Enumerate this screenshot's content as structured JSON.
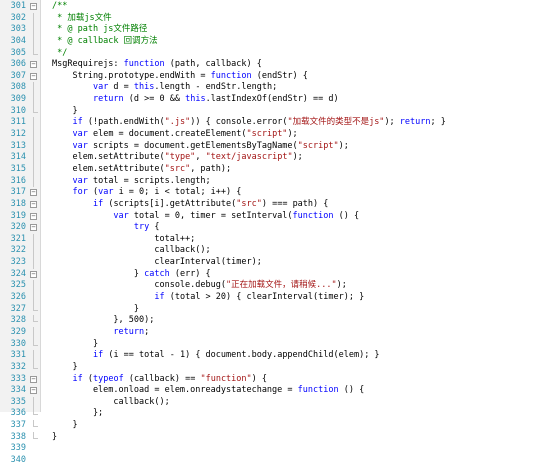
{
  "editor": {
    "lines": [
      {
        "n": "301",
        "fold": "open",
        "tokens": [
          {
            "c": "cm",
            "t": "/**"
          }
        ]
      },
      {
        "n": "302",
        "fold": "line",
        "tokens": [
          {
            "c": "cm",
            "t": " * 加载js文件"
          }
        ]
      },
      {
        "n": "303",
        "fold": "line",
        "tokens": [
          {
            "c": "cm",
            "t": " * @ path js文件路径"
          }
        ]
      },
      {
        "n": "304",
        "fold": "line",
        "tokens": [
          {
            "c": "cm",
            "t": " * @ callback 回调方法"
          }
        ]
      },
      {
        "n": "305",
        "fold": "end",
        "tokens": [
          {
            "c": "cm",
            "t": " */"
          }
        ]
      },
      {
        "n": "306",
        "fold": "open",
        "tokens": [
          {
            "c": "",
            "t": "MsgRequirejs: "
          },
          {
            "c": "kw",
            "t": "function"
          },
          {
            "c": "",
            "t": " (path, callback) {"
          }
        ]
      },
      {
        "n": "307",
        "fold": "open",
        "tokens": [
          {
            "c": "",
            "t": "    String.prototype.endWith = "
          },
          {
            "c": "kw",
            "t": "function"
          },
          {
            "c": "",
            "t": " (endStr) {"
          }
        ]
      },
      {
        "n": "308",
        "fold": "line",
        "tokens": [
          {
            "c": "",
            "t": "        "
          },
          {
            "c": "kw",
            "t": "var"
          },
          {
            "c": "",
            "t": " d = "
          },
          {
            "c": "kw",
            "t": "this"
          },
          {
            "c": "",
            "t": ".length - endStr.length;"
          }
        ]
      },
      {
        "n": "309",
        "fold": "line",
        "tokens": [
          {
            "c": "",
            "t": "        "
          },
          {
            "c": "kw",
            "t": "return"
          },
          {
            "c": "",
            "t": " (d >= 0 && "
          },
          {
            "c": "kw",
            "t": "this"
          },
          {
            "c": "",
            "t": ".lastIndexOf(endStr) == d)"
          }
        ]
      },
      {
        "n": "310",
        "fold": "end",
        "tokens": [
          {
            "c": "",
            "t": "    }"
          }
        ]
      },
      {
        "n": "311",
        "fold": "line",
        "tokens": [
          {
            "c": "",
            "t": "    "
          },
          {
            "c": "kw",
            "t": "if"
          },
          {
            "c": "",
            "t": " (!path.endWith("
          },
          {
            "c": "str",
            "t": "\".js\""
          },
          {
            "c": "",
            "t": ")) { console.error("
          },
          {
            "c": "str",
            "t": "\"加载文件的类型不是js\""
          },
          {
            "c": "",
            "t": "); "
          },
          {
            "c": "kw",
            "t": "return"
          },
          {
            "c": "",
            "t": "; }"
          }
        ]
      },
      {
        "n": "312",
        "fold": "line",
        "tokens": [
          {
            "c": "",
            "t": "    "
          },
          {
            "c": "kw",
            "t": "var"
          },
          {
            "c": "",
            "t": " elem = document.createElement("
          },
          {
            "c": "str",
            "t": "\"script\""
          },
          {
            "c": "",
            "t": ");"
          }
        ]
      },
      {
        "n": "313",
        "fold": "line",
        "tokens": [
          {
            "c": "",
            "t": "    "
          },
          {
            "c": "kw",
            "t": "var"
          },
          {
            "c": "",
            "t": " scripts = document.getElementsByTagName("
          },
          {
            "c": "str",
            "t": "\"script\""
          },
          {
            "c": "",
            "t": ");"
          }
        ]
      },
      {
        "n": "314",
        "fold": "line",
        "tokens": [
          {
            "c": "",
            "t": "    elem.setAttribute("
          },
          {
            "c": "str",
            "t": "\"type\""
          },
          {
            "c": "",
            "t": ", "
          },
          {
            "c": "str",
            "t": "\"text/javascript\""
          },
          {
            "c": "",
            "t": ");"
          }
        ]
      },
      {
        "n": "315",
        "fold": "line",
        "tokens": [
          {
            "c": "",
            "t": "    elem.setAttribute("
          },
          {
            "c": "str",
            "t": "\"src\""
          },
          {
            "c": "",
            "t": ", path);"
          }
        ]
      },
      {
        "n": "316",
        "fold": "line",
        "tokens": [
          {
            "c": "",
            "t": "    "
          },
          {
            "c": "kw",
            "t": "var"
          },
          {
            "c": "",
            "t": " total = scripts.length;"
          }
        ]
      },
      {
        "n": "317",
        "fold": "open",
        "tokens": [
          {
            "c": "",
            "t": "    "
          },
          {
            "c": "kw",
            "t": "for"
          },
          {
            "c": "",
            "t": " ("
          },
          {
            "c": "kw",
            "t": "var"
          },
          {
            "c": "",
            "t": " i = 0; i < total; i++) {"
          }
        ]
      },
      {
        "n": "318",
        "fold": "open",
        "tokens": [
          {
            "c": "",
            "t": "        "
          },
          {
            "c": "kw",
            "t": "if"
          },
          {
            "c": "",
            "t": " (scripts[i].getAttribute("
          },
          {
            "c": "str",
            "t": "\"src\""
          },
          {
            "c": "",
            "t": ") === path) {"
          }
        ]
      },
      {
        "n": "319",
        "fold": "open",
        "tokens": [
          {
            "c": "",
            "t": "            "
          },
          {
            "c": "kw",
            "t": "var"
          },
          {
            "c": "",
            "t": " total = 0, timer = setInterval("
          },
          {
            "c": "kw",
            "t": "function"
          },
          {
            "c": "",
            "t": " () {"
          }
        ]
      },
      {
        "n": "320",
        "fold": "open",
        "tokens": [
          {
            "c": "",
            "t": "                "
          },
          {
            "c": "kw",
            "t": "try"
          },
          {
            "c": "",
            "t": " {"
          }
        ]
      },
      {
        "n": "321",
        "fold": "line",
        "tokens": [
          {
            "c": "",
            "t": "                    total++;"
          }
        ]
      },
      {
        "n": "322",
        "fold": "line",
        "tokens": [
          {
            "c": "",
            "t": "                    callback();"
          }
        ]
      },
      {
        "n": "323",
        "fold": "line",
        "tokens": [
          {
            "c": "",
            "t": "                    clearInterval(timer);"
          }
        ]
      },
      {
        "n": "324",
        "fold": "open",
        "tokens": [
          {
            "c": "",
            "t": "                } "
          },
          {
            "c": "kw",
            "t": "catch"
          },
          {
            "c": "",
            "t": " (err) {"
          }
        ]
      },
      {
        "n": "325",
        "fold": "line",
        "tokens": [
          {
            "c": "",
            "t": "                    console.debug("
          },
          {
            "c": "str",
            "t": "\"正在加载文件，请稍候...\""
          },
          {
            "c": "",
            "t": ");"
          }
        ]
      },
      {
        "n": "326",
        "fold": "line",
        "tokens": [
          {
            "c": "",
            "t": "                    "
          },
          {
            "c": "kw",
            "t": "if"
          },
          {
            "c": "",
            "t": " (total > 20) { clearInterval(timer); }"
          }
        ]
      },
      {
        "n": "327",
        "fold": "end",
        "tokens": [
          {
            "c": "",
            "t": "                }"
          }
        ]
      },
      {
        "n": "328",
        "fold": "end",
        "tokens": [
          {
            "c": "",
            "t": "            }, 500);"
          }
        ]
      },
      {
        "n": "329",
        "fold": "line",
        "tokens": [
          {
            "c": "",
            "t": "            "
          },
          {
            "c": "kw",
            "t": "return"
          },
          {
            "c": "",
            "t": ";"
          }
        ]
      },
      {
        "n": "330",
        "fold": "end",
        "tokens": [
          {
            "c": "",
            "t": "        }"
          }
        ]
      },
      {
        "n": "331",
        "fold": "line",
        "tokens": [
          {
            "c": "",
            "t": "        "
          },
          {
            "c": "kw",
            "t": "if"
          },
          {
            "c": "",
            "t": " (i == total - 1) { document.body.appendChild(elem); }"
          }
        ]
      },
      {
        "n": "332",
        "fold": "end",
        "tokens": [
          {
            "c": "",
            "t": "    }"
          }
        ]
      },
      {
        "n": "333",
        "fold": "open",
        "tokens": [
          {
            "c": "",
            "t": "    "
          },
          {
            "c": "kw",
            "t": "if"
          },
          {
            "c": "",
            "t": " ("
          },
          {
            "c": "kw",
            "t": "typeof"
          },
          {
            "c": "",
            "t": " (callback) == "
          },
          {
            "c": "str",
            "t": "\"function\""
          },
          {
            "c": "",
            "t": ") {"
          }
        ]
      },
      {
        "n": "334",
        "fold": "open",
        "tokens": [
          {
            "c": "",
            "t": "        elem.onload = elem.onreadystatechange = "
          },
          {
            "c": "kw",
            "t": "function"
          },
          {
            "c": "",
            "t": " () {"
          }
        ]
      },
      {
        "n": "335",
        "fold": "line",
        "tokens": [
          {
            "c": "",
            "t": "            callback();"
          }
        ]
      },
      {
        "n": "336",
        "fold": "end",
        "tokens": [
          {
            "c": "",
            "t": "        };"
          }
        ]
      },
      {
        "n": "337",
        "fold": "end",
        "tokens": [
          {
            "c": "",
            "t": "    }"
          }
        ]
      },
      {
        "n": "338",
        "fold": "end",
        "tokens": [
          {
            "c": "",
            "t": "}"
          }
        ]
      },
      {
        "n": "339",
        "fold": "none",
        "tokens": []
      },
      {
        "n": "340",
        "fold": "none",
        "tokens": []
      }
    ]
  }
}
